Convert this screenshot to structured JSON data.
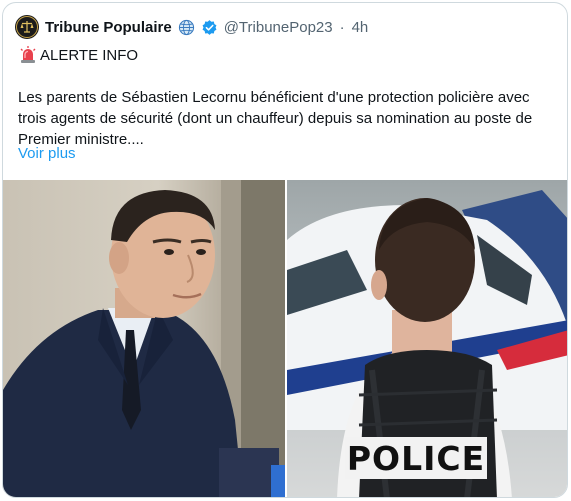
{
  "post": {
    "display_name": "Tribune Populaire",
    "handle": "@TribunePop23",
    "separator": "·",
    "time": "4h",
    "alert_label": "ALERTE INFO",
    "body": "Les parents de Sébastien Lecornu bénéficient d'une protection policière avec trois agents de sécurité (dont un chauffeur) depuis sa nomination au poste de Premier ministre....",
    "more_link": "Voir plus"
  },
  "media": {
    "right_image_vest_text": "POLICE"
  },
  "icons": {
    "avatar": "tribune-populaire-logo",
    "globe": "globe-icon",
    "verified": "verified-badge-icon",
    "alert": "rotating-light-icon"
  },
  "colors": {
    "link": "#1d9bf0",
    "secondary_text": "#536471",
    "border": "#cfd9de",
    "verified": "#1d9bf0"
  }
}
